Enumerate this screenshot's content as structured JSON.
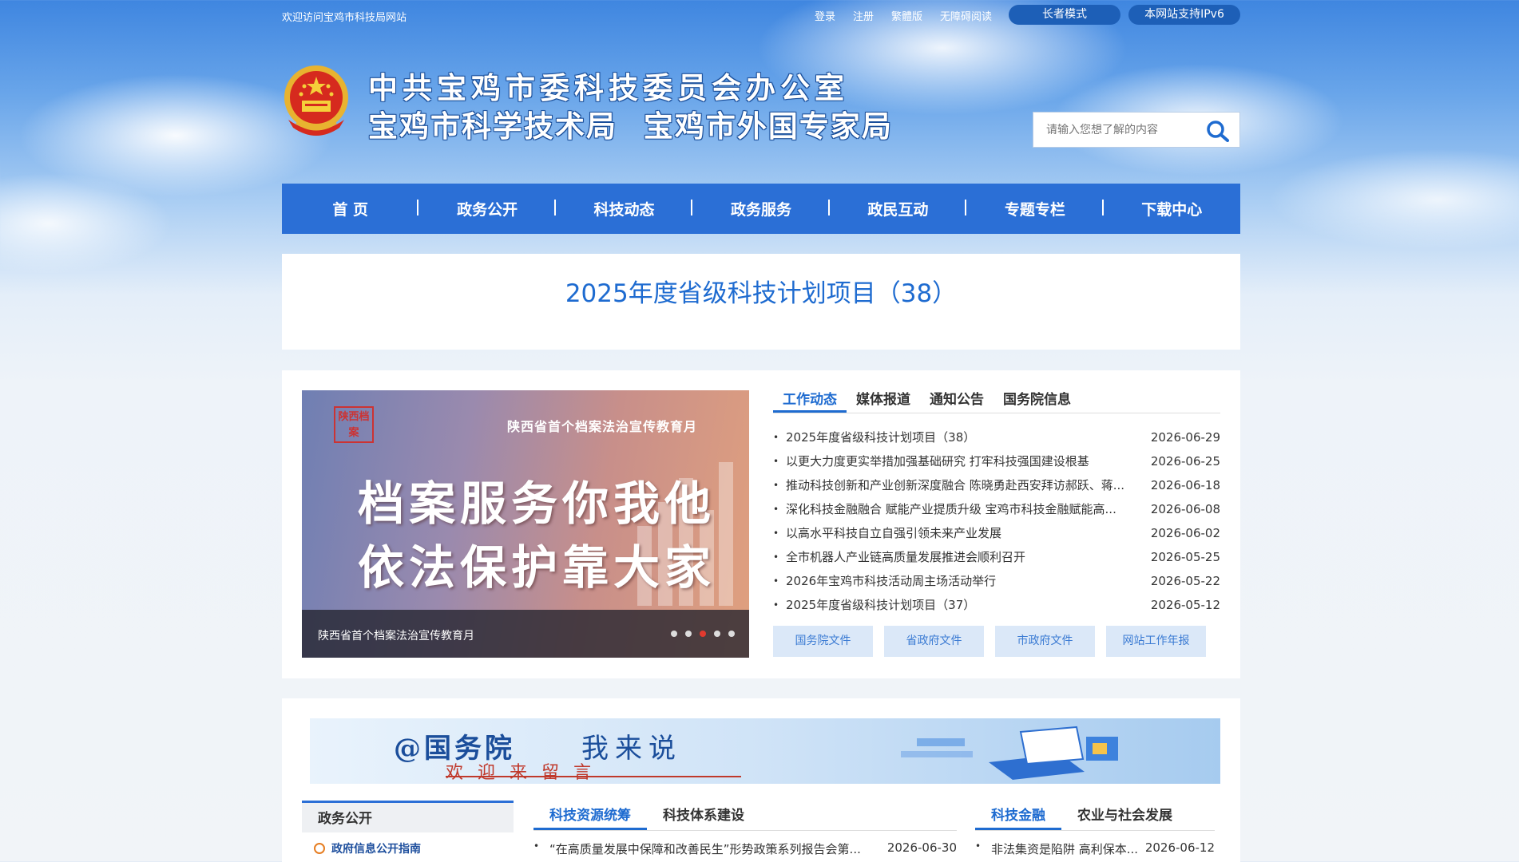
{
  "topbar": {
    "welcome": "欢迎访问宝鸡市科技局网站",
    "links": [
      "登录",
      "注册",
      "繁體版",
      "无障碍阅读"
    ],
    "elder_mode": "长者模式",
    "ipv6": "本网站支持IPv6"
  },
  "header": {
    "title_line1": "中共宝鸡市委科技委员会办公室",
    "title_line2": "宝鸡市科学技术局 宝鸡市外国专家局",
    "search_placeholder": "请输入您想了解的内容"
  },
  "nav": [
    "首 页",
    "政务公开",
    "科技动态",
    "政务服务",
    "政民互动",
    "专题专栏",
    "下载中心"
  ],
  "featured": {
    "title": "2025年度省级科技计划项目（38）"
  },
  "banner": {
    "seal": "陕西档案",
    "subtitle": "陕西省首个档案法治宣传教育月",
    "line1": "档案服务你我他",
    "line2": "依法保护靠大家",
    "caption": "陕西省首个档案法治宣传教育月",
    "dots": 5,
    "active_dot": 3
  },
  "news": {
    "tabs": [
      "工作动态",
      "媒体报道",
      "通知公告",
      "国务院信息"
    ],
    "active_tab": 0,
    "items": [
      {
        "title": "2025年度省级科技计划项目（38）",
        "date": "2026-06-29"
      },
      {
        "title": "以更大力度更实举措加强基础研究 打牢科技强国建设根基",
        "date": "2026-06-25"
      },
      {
        "title": "推动科技创新和产业创新深度融合 陈晓勇赴西安拜访郝跃、蒋...",
        "date": "2026-06-18"
      },
      {
        "title": "深化科技金融融合 赋能产业提质升级 宝鸡市科技金融赋能高...",
        "date": "2026-06-08"
      },
      {
        "title": "以高水平科技自立自强引领未来产业发展",
        "date": "2026-06-02"
      },
      {
        "title": "全市机器人产业链高质量发展推进会顺利召开",
        "date": "2026-05-25"
      },
      {
        "title": "2026年宝鸡市科技活动周主场活动举行",
        "date": "2026-05-22"
      },
      {
        "title": "2025年度省级科技计划项目（37）",
        "date": "2026-05-12"
      }
    ],
    "buttons": [
      "国务院文件",
      "省政府文件",
      "市政府文件",
      "网站工作年报"
    ]
  },
  "ad": {
    "part1": "@国务院",
    "part2": "我来说",
    "part3": "欢迎来留言"
  },
  "bottom": {
    "side_header": "政务公开",
    "side_item": "政府信息公开指南",
    "col2_tabs": [
      "科技资源统筹",
      "科技体系建设"
    ],
    "col2_item": {
      "title": "“在高质量发展中保障和改善民生”形势政策系列报告会第...",
      "date": "2026-06-30"
    },
    "col3_tabs": [
      "科技金融",
      "农业与社会发展"
    ],
    "col3_item": {
      "title": "非法集资是陷阱 高利保本...",
      "date": "2026-06-12"
    }
  }
}
